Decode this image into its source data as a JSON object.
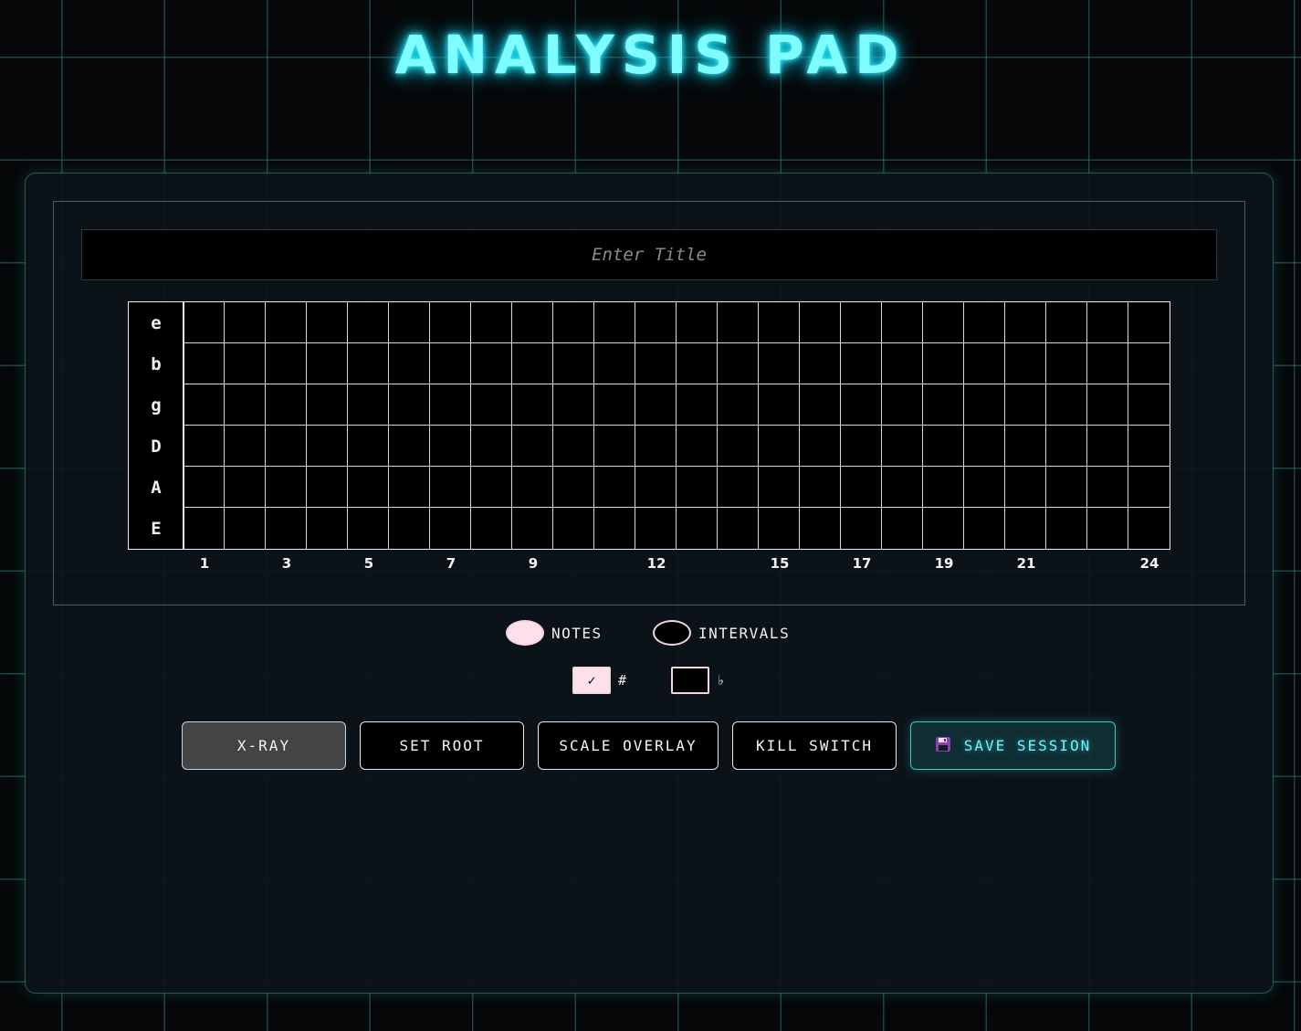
{
  "app": {
    "title": "ANALYSIS PAD"
  },
  "title_input": {
    "placeholder": "Enter Title",
    "value": ""
  },
  "fretboard": {
    "strings": [
      "e",
      "b",
      "g",
      "D",
      "A",
      "E"
    ],
    "fret_count": 24,
    "fret_markers": [
      "1",
      "3",
      "5",
      "7",
      "9",
      "12",
      "15",
      "17",
      "19",
      "21",
      "24"
    ]
  },
  "display_mode": {
    "notes_label": "NOTES",
    "intervals_label": "INTERVALS",
    "selected": "NOTES"
  },
  "accidentals": {
    "sharp_label": "#",
    "flat_label": "♭",
    "check_glyph": "✓",
    "sharp_checked": true,
    "flat_checked": false
  },
  "buttons": {
    "xray": "X-RAY",
    "set_root": "SET ROOT",
    "scale_overlay": "SCALE OVERLAY",
    "kill_switch": "KILL SWITCH",
    "save_session": "SAVE SESSION",
    "save_icon": "floppy-disk-icon",
    "active": "X-RAY"
  },
  "colors": {
    "accent_cyan": "#7ffcff",
    "toggle_pink": "#fde0ea"
  }
}
